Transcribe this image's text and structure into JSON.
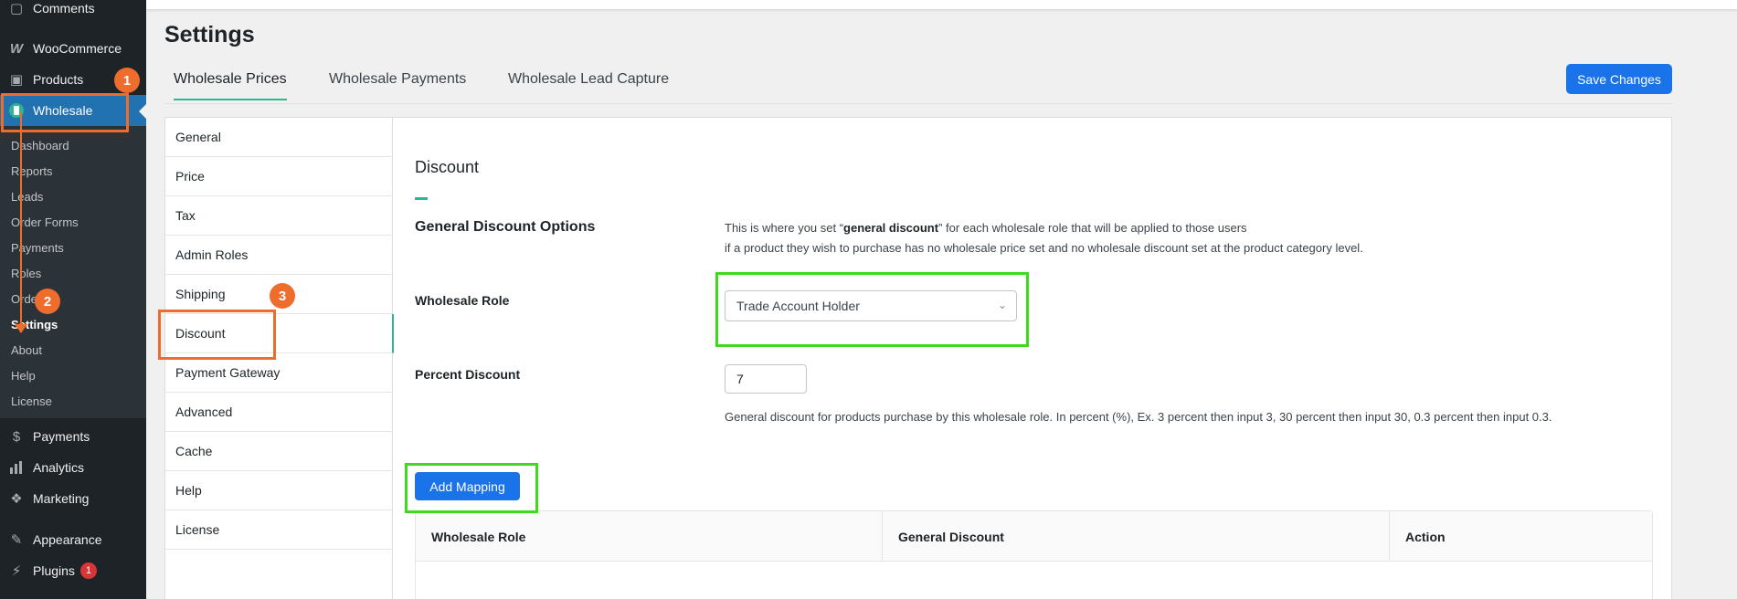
{
  "sidebar": {
    "menu": [
      {
        "label": "Comments",
        "icon": "comment-icon"
      },
      {
        "label": "WooCommerce",
        "icon": "woocommerce-icon"
      },
      {
        "label": "Products",
        "icon": "archive-icon"
      },
      {
        "label": "Wholesale",
        "icon": "wholesale-icon"
      },
      {
        "label": "Payments",
        "icon": "dollar-icon"
      },
      {
        "label": "Analytics",
        "icon": "chart-bar-icon"
      },
      {
        "label": "Marketing",
        "icon": "megaphone-icon"
      },
      {
        "label": "Appearance",
        "icon": "paintbrush-icon"
      },
      {
        "label": "Plugins",
        "icon": "plugin-icon",
        "badge": "1"
      }
    ],
    "submenu": [
      "Dashboard",
      "Reports",
      "Leads",
      "Order Forms",
      "Payments",
      "Roles",
      "Orde",
      "Settings",
      "About",
      "Help",
      "License"
    ]
  },
  "page": {
    "title": "Settings"
  },
  "tabs": [
    "Wholesale Prices",
    "Wholesale Payments",
    "Wholesale Lead Capture"
  ],
  "save_label": "Save Changes",
  "settings_nav": [
    "General",
    "Price",
    "Tax",
    "Admin Roles",
    "Shipping",
    "Discount",
    "Payment Gateway",
    "Advanced",
    "Cache",
    "Help",
    "License"
  ],
  "section": {
    "title": "Discount",
    "subtitle": "General Discount Options",
    "desc_pre": "This is where you set “",
    "desc_bold": "general discount",
    "desc_post": "” for each wholesale role that will be applied to those users",
    "desc_line2": "if a product they wish to purchase has no wholesale price set and no wholesale discount set at the product category level.",
    "role_label": "Wholesale Role",
    "role_value": "Trade Account Holder",
    "percent_label": "Percent Discount",
    "percent_value": "7",
    "percent_help": "General discount for products purchase by this wholesale role. In percent (%), Ex. 3 percent then input 3, 30 percent then input 30, 0.3 percent then input 0.3.",
    "add_mapping_label": "Add Mapping",
    "table_headers": [
      "Wholesale Role",
      "General Discount",
      "Action"
    ]
  },
  "annotations": {
    "step1": "1",
    "step2": "2",
    "step3": "3"
  },
  "colors": {
    "accent": "#2fb68e",
    "primary": "#1a73e8",
    "annotation_orange": "#ee6c2c",
    "annotation_green": "#3fd91d",
    "sidebar_bg": "#1d2327",
    "active_menu": "#2271b1"
  }
}
